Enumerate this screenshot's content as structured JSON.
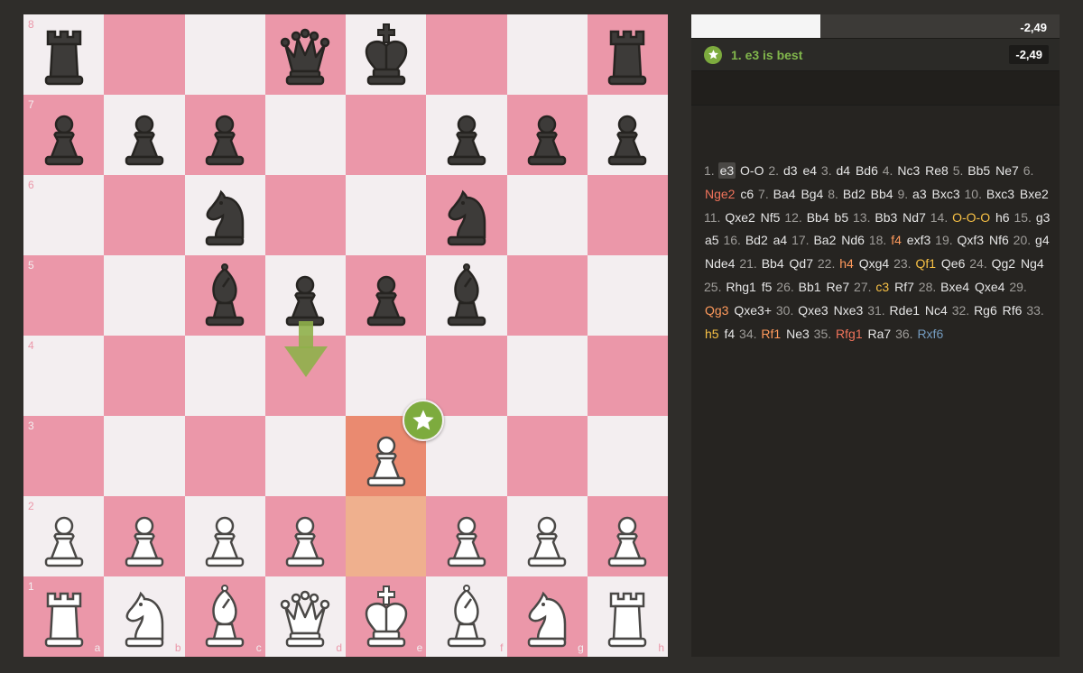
{
  "board": {
    "files": [
      "a",
      "b",
      "c",
      "d",
      "e",
      "f",
      "g",
      "h"
    ],
    "ranks": [
      "8",
      "7",
      "6",
      "5",
      "4",
      "3",
      "2",
      "1"
    ],
    "colors": {
      "light": "#f3eef0",
      "dark": "#eb97a9",
      "highlight_to": "#ea8a70",
      "highlight_from": "#efb08e"
    },
    "position": [
      [
        "bR",
        "",
        "",
        "bQ",
        "bK",
        "",
        "",
        "bR"
      ],
      [
        "bP",
        "bP",
        "bP",
        "",
        "",
        "bP",
        "bP",
        "bP"
      ],
      [
        "",
        "",
        "bN",
        "",
        "",
        "bN",
        "",
        ""
      ],
      [
        "",
        "",
        "bB",
        "bP",
        "bP",
        "bB",
        "",
        ""
      ],
      [
        "",
        "",
        "",
        "",
        "",
        "",
        "",
        ""
      ],
      [
        "",
        "",
        "",
        "",
        "wP",
        "",
        "",
        ""
      ],
      [
        "wP",
        "wP",
        "wP",
        "wP",
        "",
        "wP",
        "wP",
        "wP"
      ],
      [
        "wR",
        "wN",
        "wB",
        "wQ",
        "wK",
        "wB",
        "wN",
        "wR"
      ]
    ],
    "last_move_from": "e2",
    "last_move_to": "e3",
    "badge_icon": "star-icon",
    "arrow_icon": "arrow-down-icon"
  },
  "panel": {
    "eval_score": "-2,49",
    "eval_white_fraction": 0.35,
    "best_move_text": "1. e3 is best",
    "best_move_score": "-2,49",
    "best_icon": "star-icon"
  },
  "moves": [
    {
      "n": "1.",
      "w": "e3",
      "b": "O-O",
      "wc": "current"
    },
    {
      "n": "2.",
      "w": "d3",
      "b": "e4"
    },
    {
      "n": "3.",
      "w": "d4",
      "b": "Bd6"
    },
    {
      "n": "4.",
      "w": "Nc3",
      "b": "Re8"
    },
    {
      "n": "5.",
      "w": "Bb5",
      "b": "Ne7"
    },
    {
      "n": "6.",
      "w": "Nge2",
      "b": "c6",
      "wc": "mistake"
    },
    {
      "n": "7.",
      "w": "Ba4",
      "b": "Bg4"
    },
    {
      "n": "8.",
      "w": "Bd2",
      "b": "Bb4"
    },
    {
      "n": "9.",
      "w": "a3",
      "b": "Bxc3"
    },
    {
      "n": "10.",
      "w": "Bxc3",
      "b": "Bxe2"
    },
    {
      "n": "11.",
      "w": "Qxe2",
      "b": "Nf5"
    },
    {
      "n": "12.",
      "w": "Bb4",
      "b": "b5"
    },
    {
      "n": "13.",
      "w": "Bb3",
      "b": "Nd7"
    },
    {
      "n": "14.",
      "w": "O-O-O",
      "b": "h6",
      "wc": "inaccuracy"
    },
    {
      "n": "15.",
      "w": "g3",
      "b": "a5"
    },
    {
      "n": "16.",
      "w": "Bd2",
      "b": "a4"
    },
    {
      "n": "17.",
      "w": "Ba2",
      "b": "Nd6"
    },
    {
      "n": "18.",
      "w": "f4",
      "b": "exf3",
      "wc": "missed"
    },
    {
      "n": "19.",
      "w": "Qxf3",
      "b": "Nf6"
    },
    {
      "n": "20.",
      "w": "g4",
      "b": "Nde4"
    },
    {
      "n": "21.",
      "w": "Bb4",
      "b": "Qd7"
    },
    {
      "n": "22.",
      "w": "h4",
      "b": "Qxg4",
      "wc": "missed"
    },
    {
      "n": "23.",
      "w": "Qf1",
      "b": "Qe6",
      "wc": "inaccuracy"
    },
    {
      "n": "24.",
      "w": "Qg2",
      "b": "Ng4"
    },
    {
      "n": "25.",
      "w": "Rhg1",
      "b": "f5"
    },
    {
      "n": "26.",
      "w": "Bb1",
      "b": "Re7"
    },
    {
      "n": "27.",
      "w": "c3",
      "b": "Rf7",
      "wc": "inaccuracy"
    },
    {
      "n": "28.",
      "w": "Bxe4",
      "b": "Qxe4"
    },
    {
      "n": "29.",
      "w": "Qg3",
      "b": "Qxe3+",
      "wc": "missed"
    },
    {
      "n": "30.",
      "w": "Qxe3",
      "b": "Nxe3"
    },
    {
      "n": "31.",
      "w": "Rde1",
      "b": "Nc4"
    },
    {
      "n": "32.",
      "w": "Rg6",
      "b": "Rf6"
    },
    {
      "n": "33.",
      "w": "h5",
      "b": "f4",
      "wc": "inaccuracy"
    },
    {
      "n": "34.",
      "w": "Rf1",
      "b": "Ne3",
      "wc": "missed"
    },
    {
      "n": "35.",
      "w": "Rfg1",
      "b": "Ra7",
      "wc": "mistake"
    },
    {
      "n": "36.",
      "w": "Rxf6",
      "b": "",
      "wc": "great"
    }
  ]
}
